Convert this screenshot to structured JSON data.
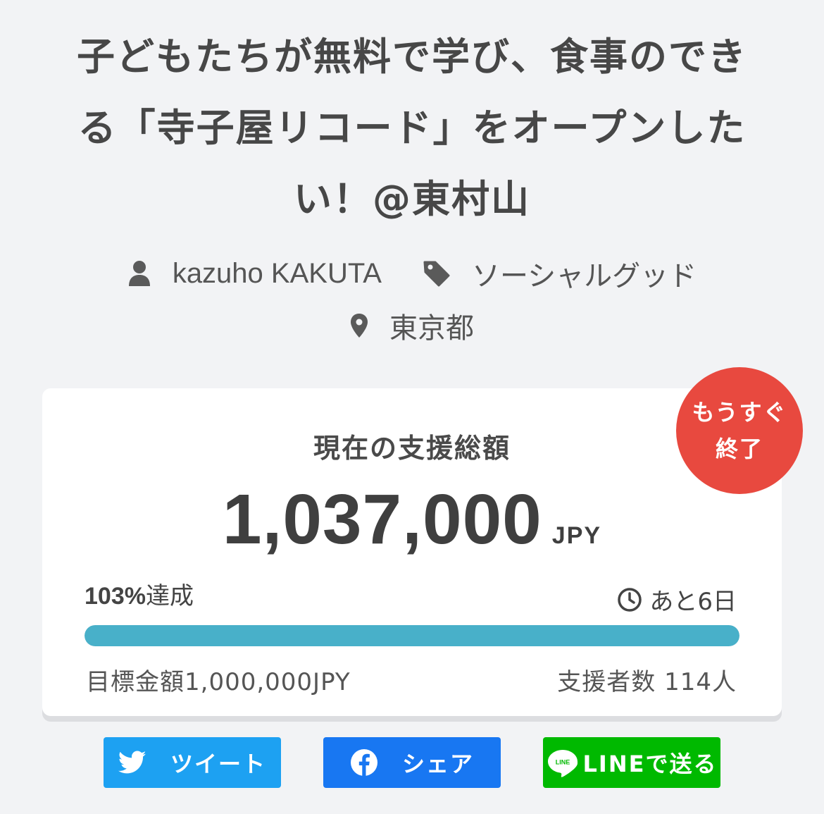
{
  "project": {
    "title_lines": [
      "子どもたちが無料で学び、食事のでき",
      "る「寺子屋リコード」をオープンした",
      "い！@東村山"
    ],
    "author": "kazuho KAKUTA",
    "category": "ソーシャルグッド",
    "location": "東京都"
  },
  "funding": {
    "label": "現在の支援総額",
    "amount": "1,037,000",
    "currency": "JPY",
    "achieved_percent": "103%",
    "achieved_suffix": "達成",
    "progress_fraction": 1.0,
    "remaining": "あと6日",
    "goal": "目標金額1,000,000JPY",
    "supporters": "支援者数 114人",
    "badge_line1": "もうすぐ",
    "badge_line2": "終了"
  },
  "share": {
    "tweet": "ツイート",
    "facebook": "シェア",
    "line": "LINEで送る"
  },
  "colors": {
    "badge": "#e8493f",
    "progress": "#48b0c9",
    "twitter": "#1da1f2",
    "facebook": "#1877f2",
    "line": "#00b900"
  },
  "icons": {
    "author": "user-icon",
    "category": "tag-icon",
    "location": "map-pin-icon",
    "remaining": "clock-icon"
  }
}
